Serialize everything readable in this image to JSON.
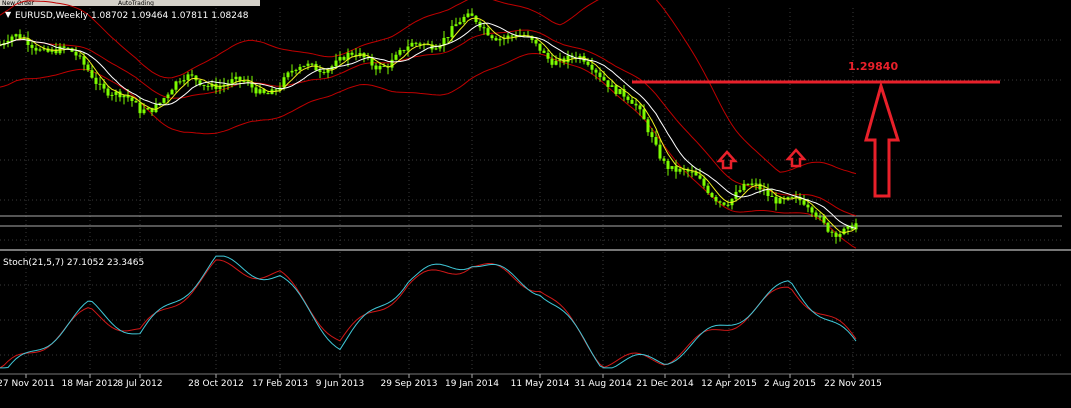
{
  "window": {
    "top_partial_label": "New Order",
    "top_partial_label2": "AutoTrading"
  },
  "main_panel": {
    "header": "EURUSD,Weekly 1.08702 1.09464 1.07811 1.08248",
    "target_label": "1.29840"
  },
  "sub_panel": {
    "header": "Stoch(21,5,7) 27.1052 23.3465"
  },
  "colors": {
    "background": "#000000",
    "candles": "#7cfc00",
    "bands": "#c00000",
    "ma_yellow": "#f0f020",
    "ma_white": "#ffffff",
    "annotation": "#e8202a",
    "stoch_main": "#40c8d8",
    "stoch_signal": "#d01818",
    "grid": "#3a3a3a"
  },
  "chart_data": [
    {
      "type": "line",
      "title": "EURUSD,Weekly",
      "x": [
        "27 Nov 2011",
        "18 Mar 2012",
        "8 Jul 2012",
        "28 Oct 2012",
        "17 Feb 2013",
        "9 Jun 2013",
        "29 Sep 2013",
        "19 Jan 2014",
        "11 May 2014",
        "31 Aug 2014",
        "21 Dec 2014",
        "12 Apr 2015",
        "2 Aug 2015",
        "22 Nov 2015"
      ],
      "series": [
        {
          "values": [
            1.35,
            1.33,
            1.25,
            1.3,
            1.3,
            1.32,
            1.36,
            1.38,
            1.37,
            1.3,
            1.18,
            1.1,
            1.1,
            1.06
          ]
        }
      ],
      "annotations": [
        "1.29840"
      ]
    },
    {
      "type": "line",
      "title": "Stoch(21,5,7) 27.1052 23.3465",
      "x": [
        "27 Nov 2011",
        "18 Mar 2012",
        "8 Jul 2012",
        "28 Oct 2012",
        "17 Feb 2013",
        "9 Jun 2013",
        "29 Sep 2013",
        "19 Jan 2014",
        "11 May 2014",
        "31 Aug 2014",
        "21 Dec 2014",
        "12 Apr 2015",
        "2 Aug 2015",
        "22 Nov 2015"
      ],
      "series": [
        {
          "values": [
            10,
            55,
            30,
            95,
            80,
            20,
            80,
            95,
            70,
            5,
            8,
            40,
            75,
            23
          ]
        },
        {
          "values": [
            12,
            50,
            32,
            90,
            82,
            25,
            75,
            93,
            72,
            7,
            9,
            38,
            72,
            27
          ]
        }
      ],
      "ylim": [
        0,
        100
      ]
    }
  ]
}
